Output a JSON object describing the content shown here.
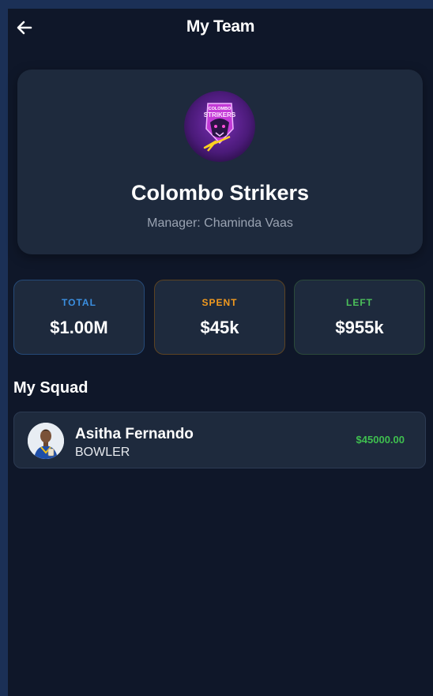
{
  "app_bar": {
    "title": "My Team"
  },
  "team": {
    "name": "Colombo Strikers",
    "manager": "Manager: Chaminda Vaas",
    "logo_text_top": "COLOMBO",
    "logo_text_main": "STRIKERS"
  },
  "budget": [
    {
      "label": "TOTAL",
      "value": "$1.00M",
      "color": "#3b8fe0",
      "border": "#254a78"
    },
    {
      "label": "SPENT",
      "value": "$45k",
      "color": "#f29a1f",
      "border": "#5c4322"
    },
    {
      "label": "LEFT",
      "value": "$955k",
      "color": "#4bbf5a",
      "border": "#2b4a3a"
    }
  ],
  "squad": {
    "title": "My Squad",
    "players": [
      {
        "name": "Asitha Fernando",
        "role": "BOWLER",
        "price": "$45000.00",
        "price_color": "#3fbf4f"
      }
    ]
  },
  "colors": {
    "background": "#0f1729",
    "card": "#1e2a3d",
    "muted_text": "#9aa3b2"
  },
  "icons": {
    "back": "arrow-left-icon"
  }
}
